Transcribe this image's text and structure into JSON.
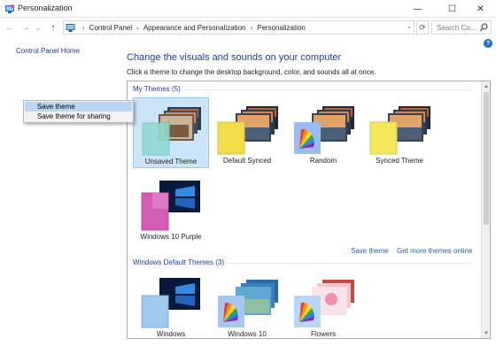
{
  "window": {
    "title": "Personalization",
    "minimize_glyph": "—",
    "maximize_glyph": "☐",
    "close_glyph": "✕"
  },
  "nav": {
    "back_glyph": "←",
    "forward_glyph": "→",
    "dropdown_glyph": "⌄",
    "up_glyph": "↑",
    "refresh_glyph": "⟳",
    "address_dropdown_glyph": "⌄"
  },
  "breadcrumbs": {
    "separator": "›",
    "items": [
      "Control Panel",
      "Appearance and Personalization",
      "Personalization"
    ]
  },
  "search": {
    "placeholder": "Search Co..."
  },
  "left_panel": {
    "home_link": "Control Panel Home"
  },
  "context_menu": {
    "items": [
      {
        "label": "Save theme",
        "highlighted": true
      },
      {
        "label": "Save theme for sharing",
        "highlighted": false
      }
    ]
  },
  "main": {
    "title": "Change the visuals and sounds on your computer",
    "description": "Click a theme to change the desktop background, color, and sounds all at once.",
    "help_glyph": "?"
  },
  "groups": {
    "my_themes": {
      "header": "My Themes (5)",
      "themes": [
        {
          "name": "Unsaved Theme",
          "selected": true,
          "color_swatch": "#8fd9cf",
          "icon": "stacked-photos-thumbnail"
        },
        {
          "name": "Default Synced",
          "selected": false,
          "color_swatch": "#f2dc4a",
          "icon": "stacked-photos-thumbnail"
        },
        {
          "name": "Random",
          "selected": false,
          "color_swatch": "#9bbcf0",
          "icon": "color-wheel-thumbnail"
        },
        {
          "name": "Synced Theme",
          "selected": false,
          "color_swatch": "#f5e85c",
          "icon": "stacked-photos-thumbnail"
        },
        {
          "name": "Windows 10 Purple",
          "selected": false,
          "color_swatch": "#d35cb6",
          "icon": "windows-desktop-thumbnail"
        }
      ]
    },
    "links": {
      "save_theme": "Save theme",
      "get_more": "Get more themes online"
    },
    "windows_default": {
      "header": "Windows Default Themes (3)",
      "themes": [
        {
          "name": "Windows",
          "color_swatch": "#9ec8ee",
          "icon": "windows-desktop-thumbnail"
        },
        {
          "name": "Windows 10",
          "color_swatch": "#a7c6f2",
          "icon": "color-wheel-thumbnail"
        },
        {
          "name": "Flowers",
          "color_swatch": "#b7d7f5",
          "icon": "color-wheel-thumbnail"
        }
      ]
    }
  },
  "colors": {
    "accent_link": "#1a3e9e",
    "selection": "#cce4f7",
    "menu_highlight": "#b9d5f2"
  }
}
